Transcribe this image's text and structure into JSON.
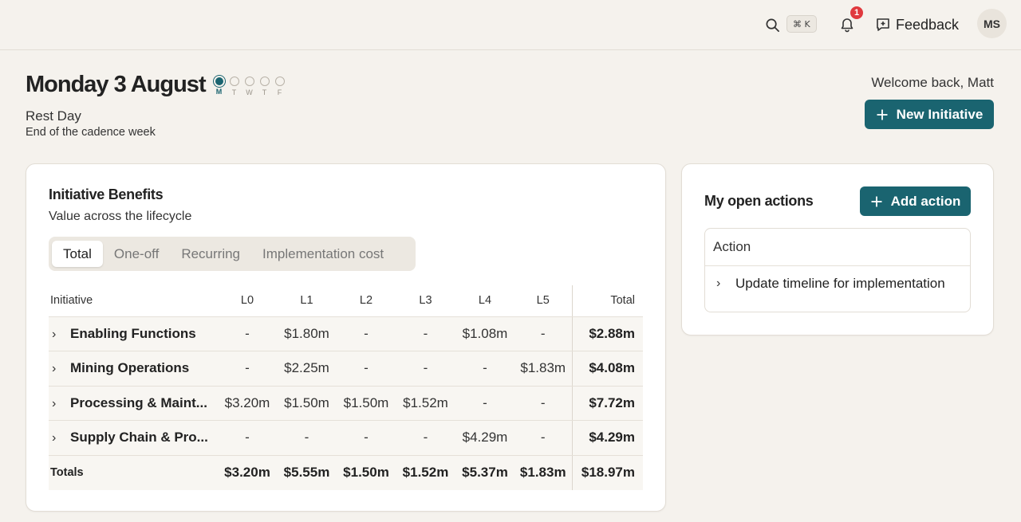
{
  "topbar": {
    "search_shortcut": "⌘ K",
    "notification_count": "1",
    "feedback_label": "Feedback",
    "avatar_initials": "MS"
  },
  "header": {
    "date_title": "Monday 3 August",
    "days": [
      "M",
      "T",
      "W",
      "T",
      "F"
    ],
    "active_day_index": 0,
    "day_status": "Rest Day",
    "day_note": "End of the cadence week",
    "welcome": "Welcome back, Matt",
    "new_initiative_label": "New Initiative"
  },
  "benefits": {
    "title": "Initiative Benefits",
    "subtitle": "Value across the lifecycle",
    "tabs": [
      "Total",
      "One-off",
      "Recurring",
      "Implementation cost"
    ],
    "active_tab": "Total",
    "columns": [
      "Initiative",
      "L0",
      "L1",
      "L2",
      "L3",
      "L4",
      "L5",
      "Total"
    ],
    "rows": [
      {
        "name": "Enabling Functions",
        "values": [
          "-",
          "$1.80m",
          "-",
          "-",
          "$1.08m",
          "-"
        ],
        "total": "$2.88m"
      },
      {
        "name": "Mining Operations",
        "values": [
          "-",
          "$2.25m",
          "-",
          "-",
          "-",
          "$1.83m"
        ],
        "total": "$4.08m"
      },
      {
        "name": "Processing & Maint...",
        "values": [
          "$3.20m",
          "$1.50m",
          "$1.50m",
          "$1.52m",
          "-",
          "-"
        ],
        "total": "$7.72m"
      },
      {
        "name": "Supply Chain & Pro...",
        "values": [
          "-",
          "-",
          "-",
          "-",
          "$4.29m",
          "-"
        ],
        "total": "$4.29m"
      }
    ],
    "totals": {
      "label": "Totals",
      "values": [
        "$3.20m",
        "$5.55m",
        "$1.50m",
        "$1.52m",
        "$5.37m",
        "$1.83m"
      ],
      "total": "$18.97m"
    }
  },
  "actions": {
    "title": "My open actions",
    "add_label": "Add action",
    "column": "Action",
    "items": [
      "Update timeline for implementation"
    ]
  },
  "colors": {
    "accent": "#1a6470",
    "badge": "#e0393e",
    "background": "#f5f2ed"
  }
}
